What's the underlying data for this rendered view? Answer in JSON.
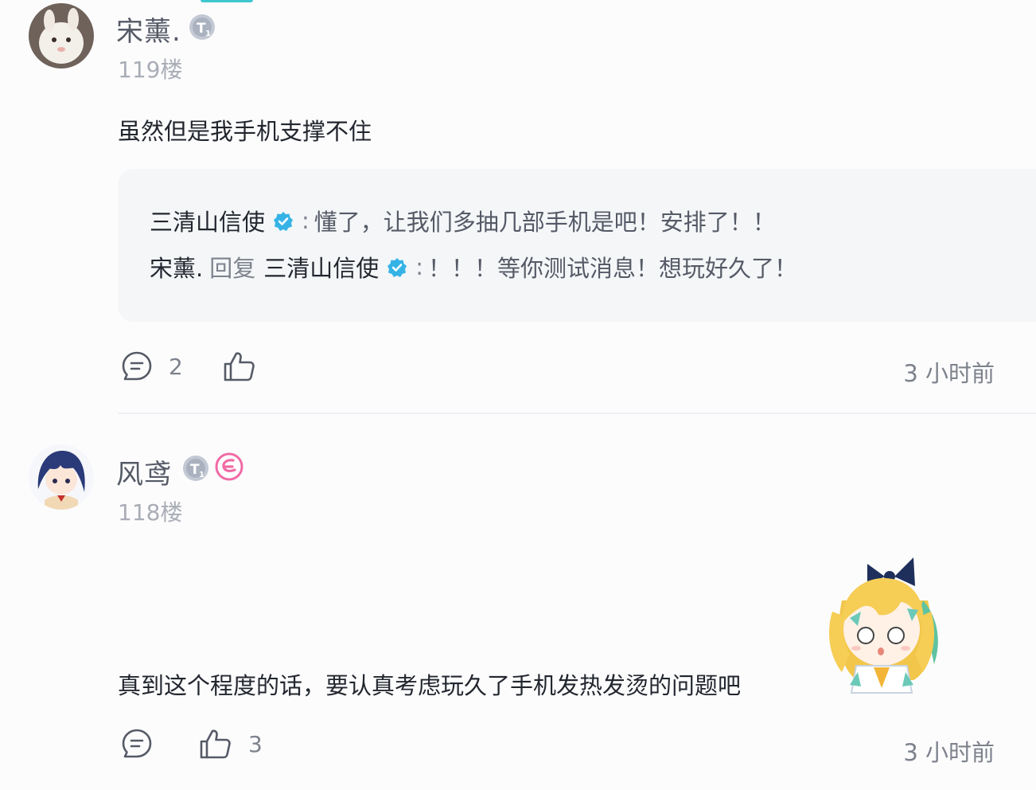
{
  "comments": [
    {
      "username": "宋薰.",
      "floor": "119楼",
      "content": "虽然但是我手机支撑不住",
      "replies": [
        {
          "name": "三清山信使",
          "text": "懂了，让我们多抽几部手机是吧！安排了！！"
        },
        {
          "name": "宋薰.",
          "verb": "回复",
          "target": "三清山信使",
          "text": "！！！等你测试消息！想玩好久了！"
        }
      ],
      "reply_count": "2",
      "like_count": "",
      "time": "3 小时前"
    },
    {
      "username": "风鸢",
      "floor": "118楼",
      "content": "真到这个程度的话，要认真考虑玩久了手机发热发烫的问题吧",
      "reply_count": "",
      "like_count": "3",
      "time": "3 小时前"
    }
  ],
  "separator": ":",
  "colors": {
    "verified": "#36b3e6",
    "level_badge": "#b8bfcc",
    "pink_badge": "#f06aa5",
    "accent": "#3ec7cf"
  }
}
